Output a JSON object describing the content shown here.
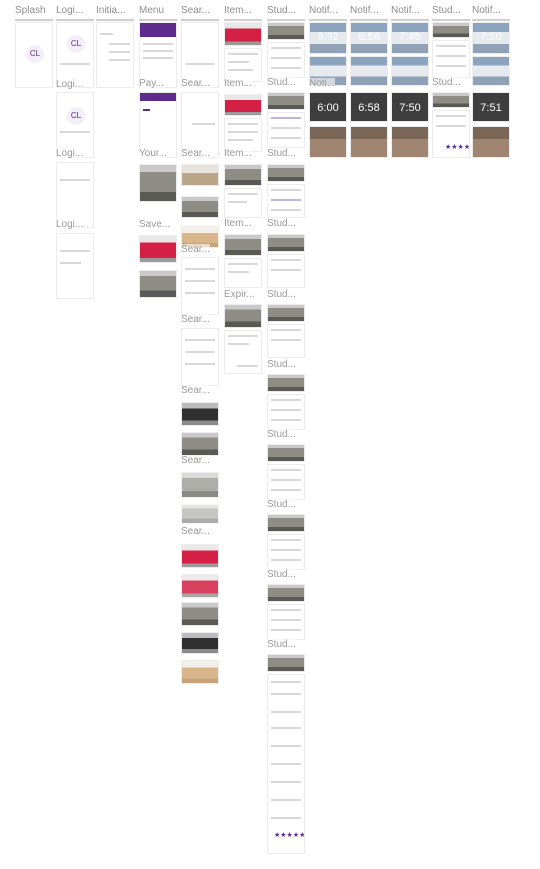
{
  "columns": [
    {
      "label": "Splash"
    },
    {
      "label": "Logi..."
    },
    {
      "label": "Initia..."
    },
    {
      "label": "Menu"
    },
    {
      "label": "Sear..."
    },
    {
      "label": "Item..."
    },
    {
      "label": "Stud..."
    },
    {
      "label": "Notif..."
    },
    {
      "label": "Notif..."
    },
    {
      "label": "Notif..."
    },
    {
      "label": "Stud..."
    },
    {
      "label": "Notif..."
    }
  ],
  "group_labels": {
    "login_2": "Logi...",
    "login_3": "Logi...",
    "login_4": "Logi...",
    "menu_2": "Pay...",
    "menu_3": "Your...",
    "menu_4": "Save...",
    "search_2": "Sear...",
    "search_3": "Sear...",
    "search_4": "Sear...",
    "search_5": "Sear...",
    "search_6": "Sear...",
    "search_7": "Sear...",
    "search_8": "Sear...",
    "item_2": "Item...",
    "item_3": "Item...",
    "item_4": "Item...",
    "item_5": "Expir...",
    "stud_2": "Stud...",
    "stud_3": "Stud...",
    "stud_4": "Stud...",
    "stud_5": "Stud...",
    "stud_6": "Stud...",
    "stud_7": "Stud...",
    "stud_8": "Stud...",
    "stud_9": "Stud...",
    "stud_10": "Stud...",
    "notif_row2_a": "Noti...",
    "stud_col11": "Stud..."
  },
  "logo_text": "CL",
  "notification_times": {
    "row1": [
      "6:32",
      "6:58",
      "7:45",
      "7:50"
    ],
    "row2": [
      "6:00",
      "6:58",
      "7:50",
      "7:51"
    ]
  },
  "stars": "★★★★★"
}
